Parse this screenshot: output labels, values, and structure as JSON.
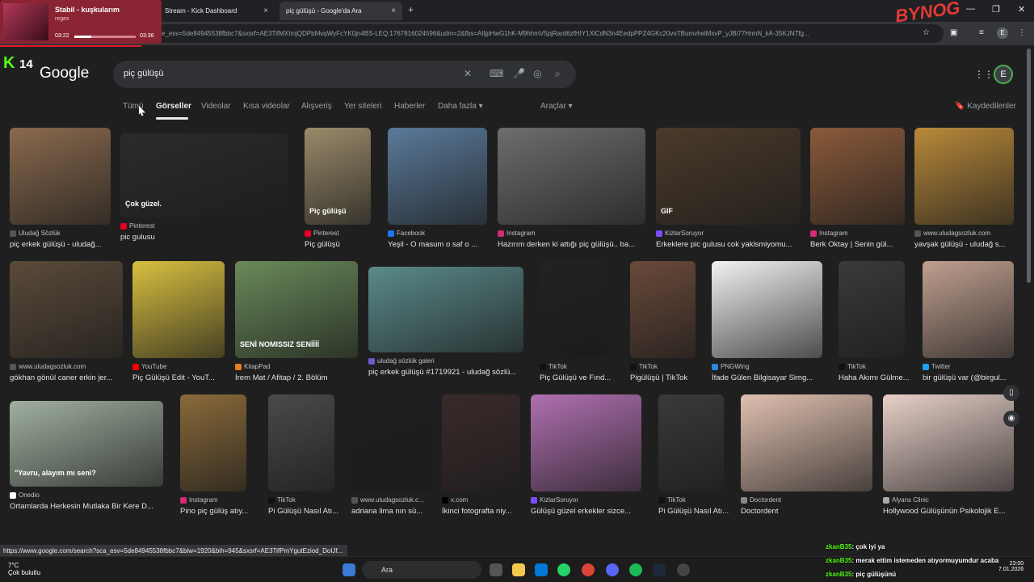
{
  "browser": {
    "tabs": [
      {
        "label": "Stream - Kick Dashboard",
        "close": "×"
      },
      {
        "label": "piç gülüşü - Google'da Ara",
        "close": "×"
      }
    ],
    "new_tab": "+",
    "url": "e_esv=5de84945538fbbc7&sxsrf=AE3TifMXImjQDPbMvqWyFcYK0jn4BS-LEQ:1767816024596&udm=2&fbs=AIljpHwG1hK-M9hhmV5pjRard6zfHIY1XlCdN3n4EedpPPZ4GKc20voTBumvhelMxvP_yJBi77HrmN_kA-35KJNTfg...",
    "status_url": "https://www.google.com/search?sca_esv=5de84945538fbbc7&biw=1920&bih=945&sxsrf=AE3TifPmYgutEziod_DoIJf...",
    "profile_initial": "E"
  },
  "spotify": {
    "song": "Stabil - kuşkularım",
    "artist": "regex",
    "elapsed": "03:22",
    "total": "03:36",
    "progress": 0.27
  },
  "stream_badge": {
    "brand": "K",
    "number": "14"
  },
  "overlay_logo": "BYNOG",
  "google": {
    "logo": "Google",
    "query": "piç gülüşü",
    "account_initial": "E",
    "nav": [
      "Tümü",
      "Görseller",
      "Videolar",
      "Kısa videolar",
      "Alışveriş",
      "Yer siteleri",
      "Haberler",
      "Daha fazla ▾"
    ],
    "tools": "Araçlar ▾",
    "saved": "Kaydedilenler"
  },
  "results": [
    {
      "src": "Uludağ Sözlük",
      "title": "piç erkek gülüşü - uludağ...",
      "fav": "#555"
    },
    {
      "src": "Pinterest",
      "title": "pic gulusu",
      "fav": "#e60023",
      "overlay": "Çok güzel."
    },
    {
      "src": "Pinterest",
      "title": "Piç gülüşü",
      "fav": "#e60023",
      "overlay": "Piç gülüşü"
    },
    {
      "src": "Facebook",
      "title": "Yeşil - O masum o saf o ...",
      "fav": "#1877f2"
    },
    {
      "src": "Instagram",
      "title": "Hazırım derken ki attığı piç gülüşü.. ba...",
      "fav": "#d62976"
    },
    {
      "src": "KizlarSoruyor",
      "title": "Erkeklere pic gulusu cok yakismiyomu...",
      "fav": "#7c4dff",
      "overlay": "GIF"
    },
    {
      "src": "Instagram",
      "title": "Berk Oktay | Senin gül...",
      "fav": "#d62976"
    },
    {
      "src": "www.uludagsozluk.com",
      "title": "yavşak gülüşü - uludağ s...",
      "fav": "#555"
    },
    {
      "src": "www.uludagsozluk.com",
      "title": "gökhan gönül caner erkin jer...",
      "fav": "#555"
    },
    {
      "src": "YouTube",
      "title": "Piç Gülüşü Edit - YouT...",
      "fav": "#ff0000"
    },
    {
      "src": "KitapPad",
      "title": "İrem Mat / Afitap / 2. Bölüm",
      "fav": "#e67e22",
      "overlay": "SENİ NOMISSIZ SENİİİİ"
    },
    {
      "src": "uludağ sözlük galeri",
      "title": "piç erkek gülüşü #1719921 - uludağ sözlü...",
      "fav": "#6a5acd"
    },
    {
      "src": "TikTok",
      "title": "Piç Gülüşü ve Fınd...",
      "fav": "#111"
    },
    {
      "src": "TikTok",
      "title": "Pigülüşü | TikTok",
      "fav": "#111"
    },
    {
      "src": "PNGWing",
      "title": "İfade Gülen Bilgisayar Simg...",
      "fav": "#2e86de"
    },
    {
      "src": "TikTok",
      "title": "Haha Akımı Gülme...",
      "fav": "#111"
    },
    {
      "src": "Twitter",
      "title": "bir gülüşü var (@birgul...",
      "fav": "#1da1f2"
    },
    {
      "src": "Onedio",
      "title": "Ortamlarda Herkesin Mutlaka Bir Kere D...",
      "fav": "#fff",
      "overlay": "\"Yavru, alayım mı seni?"
    },
    {
      "src": "Instagram",
      "title": "Pino piç gülüş atıy...",
      "fav": "#d62976"
    },
    {
      "src": "TikTok",
      "title": "Pi Gülüşü Nasıl Atı...",
      "fav": "#111"
    },
    {
      "src": "www.uludagsozluk.c...",
      "title": "adriana lima nın sü...",
      "fav": "#555"
    },
    {
      "src": "x.com",
      "title": "İkinci fotografta niy...",
      "fav": "#000"
    },
    {
      "src": "KizlarSoruyor",
      "title": "Gülüşü güzel erkekler sizce...",
      "fav": "#7c4dff"
    },
    {
      "src": "TikTok",
      "title": "Pi Gülüşü Nasıl Atı...",
      "fav": "#111"
    },
    {
      "src": "Doctordent",
      "title": "Doctordent",
      "fav": "#888"
    },
    {
      "src": "Alyans Clinic",
      "title": "Hollywood Gülüşünün Psikolojik E...",
      "fav": "#aaa"
    }
  ],
  "taskbar": {
    "temp": "7°C",
    "weather": "Çok bulutlu",
    "search": "Ara",
    "time": "23:00",
    "date": "7.01.2026"
  },
  "chat": [
    {
      "user": "zkanB35",
      "msg": ": çok iyi ya"
    },
    {
      "user": "zkanB35",
      "msg": ": merak ettim istemeden atıyormuyumdur acaba"
    },
    {
      "user": "zkanB35",
      "msg": ": piç gülüşünü"
    }
  ],
  "colors": {
    "kick_green": "#53fc18",
    "accent_red": "#e91429"
  }
}
